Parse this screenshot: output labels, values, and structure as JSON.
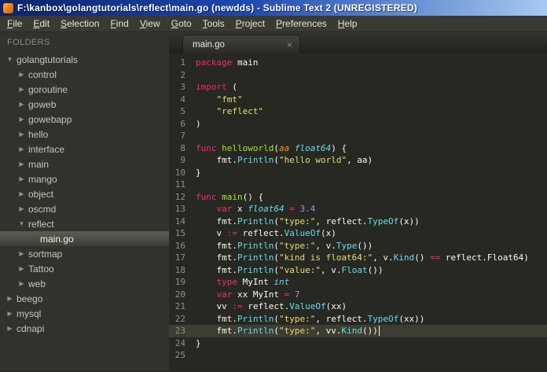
{
  "window": {
    "title": "F:\\kanbox\\golangtutorials\\reflect\\main.go (newdds) - Sublime Text 2 (UNREGISTERED)"
  },
  "menu": {
    "items": [
      "File",
      "Edit",
      "Selection",
      "Find",
      "View",
      "Goto",
      "Tools",
      "Project",
      "Preferences",
      "Help"
    ]
  },
  "sidebar": {
    "header": "FOLDERS",
    "items": [
      {
        "label": "golangtutorials",
        "level": 0,
        "state": "expanded",
        "selected": false
      },
      {
        "label": "control",
        "level": 1,
        "state": "collapsed",
        "selected": false
      },
      {
        "label": "goroutine",
        "level": 1,
        "state": "collapsed",
        "selected": false
      },
      {
        "label": "goweb",
        "level": 1,
        "state": "collapsed",
        "selected": false
      },
      {
        "label": "gowebapp",
        "level": 1,
        "state": "collapsed",
        "selected": false
      },
      {
        "label": "hello",
        "level": 1,
        "state": "collapsed",
        "selected": false
      },
      {
        "label": "interface",
        "level": 1,
        "state": "collapsed",
        "selected": false
      },
      {
        "label": "main",
        "level": 1,
        "state": "collapsed",
        "selected": false
      },
      {
        "label": "mango",
        "level": 1,
        "state": "collapsed",
        "selected": false
      },
      {
        "label": "object",
        "level": 1,
        "state": "collapsed",
        "selected": false
      },
      {
        "label": "oscmd",
        "level": 1,
        "state": "collapsed",
        "selected": false
      },
      {
        "label": "reflect",
        "level": 1,
        "state": "expanded",
        "selected": false
      },
      {
        "label": "main.go",
        "level": 2,
        "state": "none",
        "selected": true
      },
      {
        "label": "sortmap",
        "level": 1,
        "state": "collapsed",
        "selected": false
      },
      {
        "label": "Tattoo",
        "level": 1,
        "state": "collapsed",
        "selected": false
      },
      {
        "label": "web",
        "level": 1,
        "state": "collapsed",
        "selected": false
      },
      {
        "label": "beego",
        "level": 0,
        "state": "collapsed",
        "selected": false
      },
      {
        "label": "mysql",
        "level": 0,
        "state": "collapsed",
        "selected": false
      },
      {
        "label": "cdnapi",
        "level": 0,
        "state": "collapsed",
        "selected": false
      }
    ]
  },
  "tabs": [
    {
      "label": "main.go",
      "close_glyph": "×",
      "active": true
    }
  ],
  "editor": {
    "cursor_line": 23,
    "lines": [
      [
        [
          "k",
          "package"
        ],
        [
          "p",
          " main"
        ]
      ],
      [],
      [
        [
          "k",
          "import"
        ],
        [
          "p",
          " ("
        ]
      ],
      [
        [
          "p",
          "    "
        ],
        [
          "s",
          "\"fmt\""
        ]
      ],
      [
        [
          "p",
          "    "
        ],
        [
          "s",
          "\"reflect\""
        ]
      ],
      [
        [
          "p",
          ")"
        ]
      ],
      [],
      [
        [
          "k",
          "func"
        ],
        [
          "p",
          " "
        ],
        [
          "f",
          "helloworld"
        ],
        [
          "p",
          "("
        ],
        [
          "a",
          "aa"
        ],
        [
          "p",
          " "
        ],
        [
          "t",
          "float64"
        ],
        [
          "p",
          ") {"
        ]
      ],
      [
        [
          "p",
          "    fmt."
        ],
        [
          "c",
          "Println"
        ],
        [
          "p",
          "("
        ],
        [
          "s",
          "\"hello world\""
        ],
        [
          "p",
          ", aa)"
        ]
      ],
      [
        [
          "p",
          "}"
        ]
      ],
      [],
      [
        [
          "k",
          "func"
        ],
        [
          "p",
          " "
        ],
        [
          "f",
          "main"
        ],
        [
          "p",
          "() {"
        ]
      ],
      [
        [
          "p",
          "    "
        ],
        [
          "k",
          "var"
        ],
        [
          "p",
          " x "
        ],
        [
          "t",
          "float64"
        ],
        [
          "p",
          " "
        ],
        [
          "k",
          "="
        ],
        [
          "p",
          " "
        ],
        [
          "n",
          "3.4"
        ]
      ],
      [
        [
          "p",
          "    fmt."
        ],
        [
          "c",
          "Println"
        ],
        [
          "p",
          "("
        ],
        [
          "s",
          "\"type:\""
        ],
        [
          "p",
          ", reflect."
        ],
        [
          "c",
          "TypeOf"
        ],
        [
          "p",
          "(x))"
        ]
      ],
      [
        [
          "p",
          "    v "
        ],
        [
          "k",
          ":="
        ],
        [
          "p",
          " reflect."
        ],
        [
          "c",
          "ValueOf"
        ],
        [
          "p",
          "(x)"
        ]
      ],
      [
        [
          "p",
          "    fmt."
        ],
        [
          "c",
          "Println"
        ],
        [
          "p",
          "("
        ],
        [
          "s",
          "\"type:\""
        ],
        [
          "p",
          ", v."
        ],
        [
          "c",
          "Type"
        ],
        [
          "p",
          "())"
        ]
      ],
      [
        [
          "p",
          "    fmt."
        ],
        [
          "c",
          "Println"
        ],
        [
          "p",
          "("
        ],
        [
          "s",
          "\"kind is float64:\""
        ],
        [
          "p",
          ", v."
        ],
        [
          "c",
          "Kind"
        ],
        [
          "p",
          "() "
        ],
        [
          "k",
          "=="
        ],
        [
          "p",
          " reflect.Float64)"
        ]
      ],
      [
        [
          "p",
          "    fmt."
        ],
        [
          "c",
          "Println"
        ],
        [
          "p",
          "("
        ],
        [
          "s",
          "\"value:\""
        ],
        [
          "p",
          ", v."
        ],
        [
          "c",
          "Float"
        ],
        [
          "p",
          "())"
        ]
      ],
      [
        [
          "p",
          "    "
        ],
        [
          "k",
          "type"
        ],
        [
          "p",
          " MyInt "
        ],
        [
          "t",
          "int"
        ]
      ],
      [
        [
          "p",
          "    "
        ],
        [
          "k",
          "var"
        ],
        [
          "p",
          " xx MyInt "
        ],
        [
          "k",
          "="
        ],
        [
          "p",
          " "
        ],
        [
          "n",
          "7"
        ]
      ],
      [
        [
          "p",
          "    vv "
        ],
        [
          "k",
          ":="
        ],
        [
          "p",
          " reflect."
        ],
        [
          "c",
          "ValueOf"
        ],
        [
          "p",
          "(xx)"
        ]
      ],
      [
        [
          "p",
          "    fmt."
        ],
        [
          "c",
          "Println"
        ],
        [
          "p",
          "("
        ],
        [
          "s",
          "\"type:\""
        ],
        [
          "p",
          ", reflect."
        ],
        [
          "c",
          "TypeOf"
        ],
        [
          "p",
          "(xx))"
        ]
      ],
      [
        [
          "p",
          "    fmt."
        ],
        [
          "c",
          "Println"
        ],
        [
          "p",
          "("
        ],
        [
          "s",
          "\"type:\""
        ],
        [
          "p",
          ", vv."
        ],
        [
          "c",
          "Kind"
        ],
        [
          "p",
          "())"
        ]
      ],
      [
        [
          "p",
          "}"
        ]
      ],
      []
    ]
  },
  "colors": {
    "editor_bg": "#272822",
    "current_line": "#3e3d32",
    "gutter": "#8f908a",
    "plain": "#f8f8f2",
    "keyword": "#f92672",
    "string": "#e6db74",
    "fname": "#a6e22e",
    "type": "#66d9ef",
    "number": "#ae81ff",
    "param": "#fd971f",
    "sidebar_bg": "#32322c",
    "titlebar_left": "#0a246a",
    "titlebar_right": "#a6caf0"
  }
}
